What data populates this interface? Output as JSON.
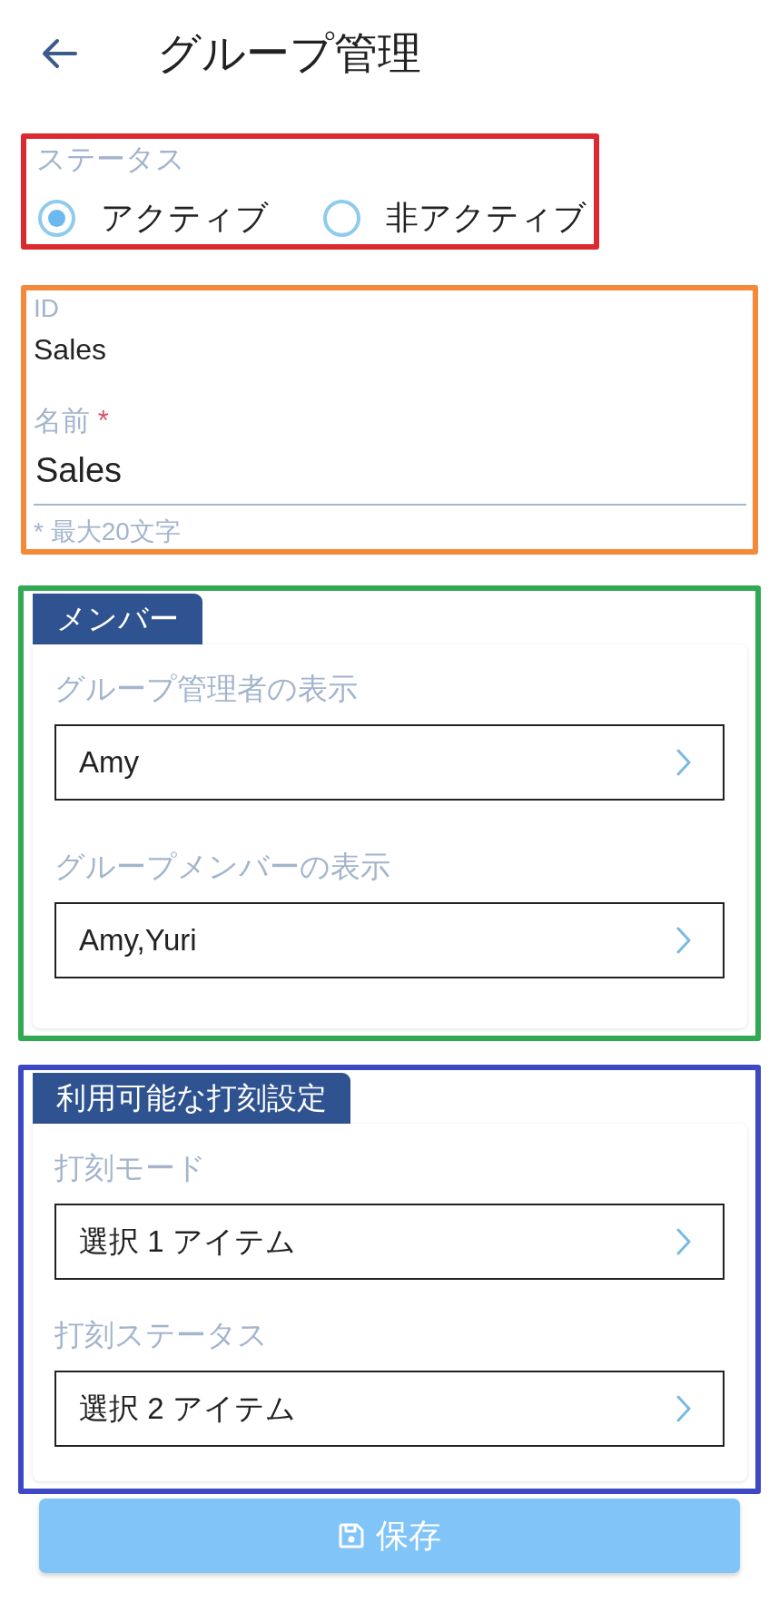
{
  "header": {
    "title": "グループ管理"
  },
  "status": {
    "color": "#db2b30",
    "label": "ステータス",
    "options": [
      {
        "label": "アクティブ",
        "selected": true
      },
      {
        "label": "非アクティブ",
        "selected": false
      }
    ]
  },
  "identity": {
    "color": "#f5893a",
    "id_label": "ID",
    "id_value": "Sales",
    "name_label": "名前",
    "required_mark": "*",
    "name_value": "Sales",
    "hint": "* 最大20文字"
  },
  "sections": [
    {
      "color": "#31a952",
      "title": "メンバー",
      "fields": [
        {
          "label": "グループ管理者の表示",
          "value": "Amy"
        },
        {
          "label": "グループメンバーの表示",
          "value": "Amy,Yuri"
        }
      ]
    },
    {
      "color": "#3d48c2",
      "title": "利用可能な打刻設定",
      "fields": [
        {
          "label": "打刻モード",
          "value": "選択 1 アイテム"
        },
        {
          "label": "打刻ステータス",
          "value": "選択 2 アイテム"
        }
      ]
    }
  ],
  "save_button": {
    "label": "保存"
  }
}
